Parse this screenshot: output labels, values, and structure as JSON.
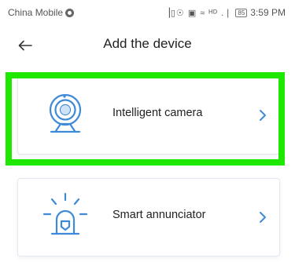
{
  "status_bar": {
    "carrier": "China Mobile",
    "icons": "▕▯☉ ▣ ≈ ᴴᴰ .❘",
    "battery": "85",
    "time": "3:59 PM"
  },
  "header": {
    "back_icon": "arrow-left-icon",
    "title": "Add the device"
  },
  "devices": [
    {
      "label": "Intelligent camera",
      "icon": "camera-icon",
      "selected": true
    },
    {
      "label": "Smart annunciator",
      "icon": "alarm-icon",
      "selected": false
    }
  ],
  "colors": {
    "accent": "#3f8ad8",
    "highlight": "#1ee800",
    "card_border": "#e2e6ee"
  }
}
